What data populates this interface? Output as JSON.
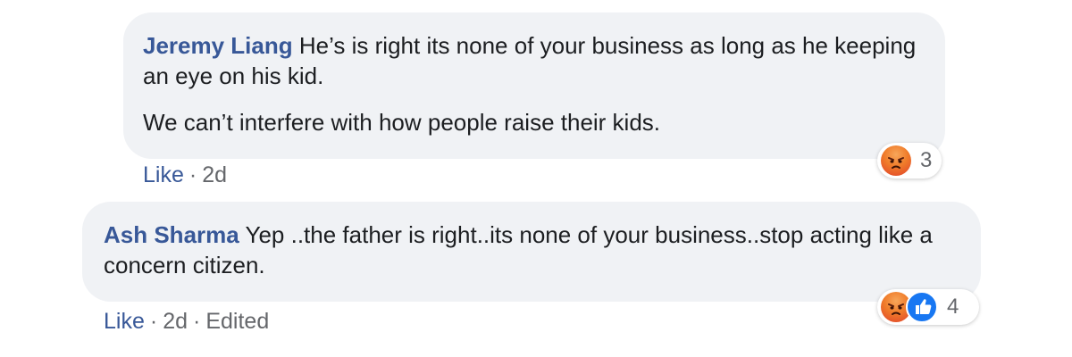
{
  "comments": [
    {
      "author": "Jeremy Liang",
      "text_1": "He’s is right its none of your business as long as he keeping an eye on his kid.",
      "text_2": "We can’t interfere with how people raise their kids.",
      "actions": {
        "like": "Like",
        "separator": "·",
        "time": "2d"
      },
      "reactions": {
        "icons": [
          "angry-icon"
        ],
        "count": "3"
      }
    },
    {
      "author": "Ash Sharma",
      "text_1": "Yep ..the father is right..its none of your business..stop acting like a concern citizen.",
      "actions": {
        "like": "Like",
        "separator": "·",
        "time": "2d",
        "edited": "Edited"
      },
      "reactions": {
        "icons": [
          "angry-icon",
          "like-reaction-icon"
        ],
        "count": "4"
      }
    }
  ],
  "colors": {
    "author": "#385898",
    "bubble": "#f0f2f5",
    "meta": "#65676b",
    "like_blue": "#1877f2",
    "angry": "#f07c2a"
  }
}
